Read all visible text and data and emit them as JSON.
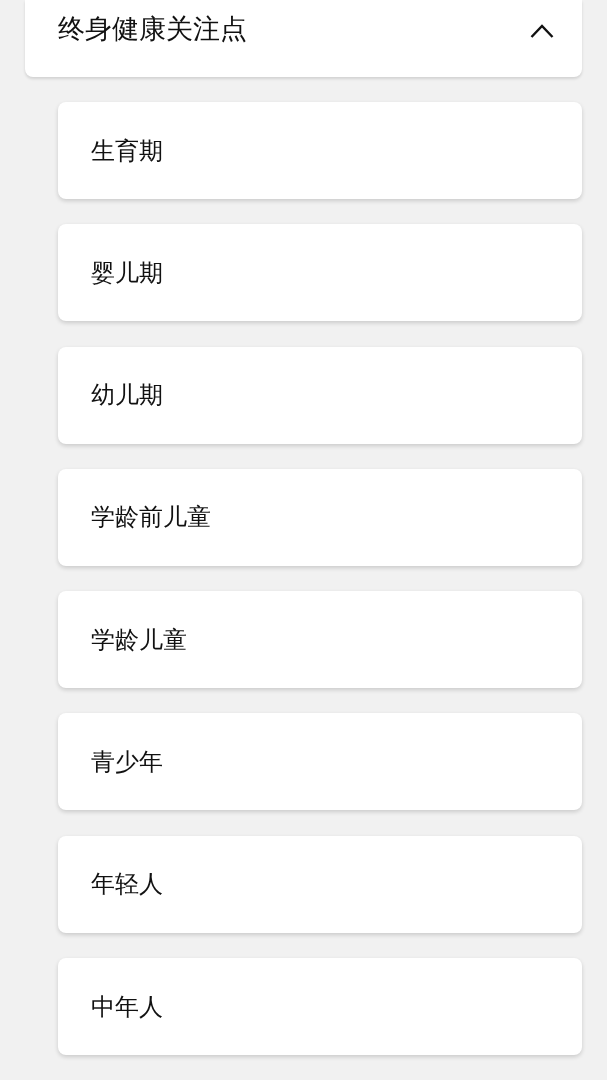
{
  "section": {
    "title": "终身健康关注点",
    "expanded": true
  },
  "items": [
    {
      "label": "生育期"
    },
    {
      "label": "婴儿期"
    },
    {
      "label": "幼儿期"
    },
    {
      "label": "学龄前儿童"
    },
    {
      "label": "学龄儿童"
    },
    {
      "label": "青少年"
    },
    {
      "label": "年轻人"
    },
    {
      "label": "中年人"
    }
  ]
}
